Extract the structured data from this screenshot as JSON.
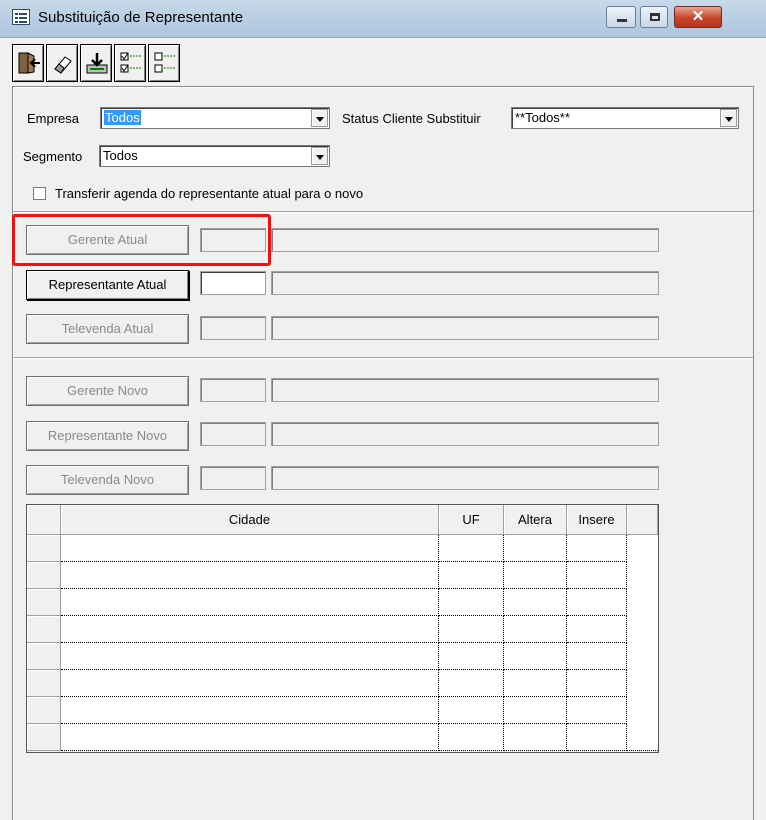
{
  "window": {
    "title": "Substituição de Representante"
  },
  "toolbar": {
    "buttons": [
      {
        "icon": "exit-door-icon"
      },
      {
        "icon": "eraser-icon"
      },
      {
        "icon": "download-tray-icon"
      },
      {
        "icon": "check-all-icon"
      },
      {
        "icon": "uncheck-all-icon"
      }
    ]
  },
  "filters": {
    "empresa_label": "Empresa",
    "empresa_value": "Todos",
    "status_label": "Status Cliente Substituir",
    "status_value": "**Todos**",
    "segmento_label": "Segmento",
    "segmento_value": "Todos",
    "transfer_label": "Transferir agenda do representante atual para o novo",
    "transfer_checked": false
  },
  "current": {
    "gerente_label": "Gerente Atual",
    "representante_label": "Representante Atual",
    "televenda_label": "Televenda Atual"
  },
  "new": {
    "gerente_label": "Gerente Novo",
    "representante_label": "Representante Novo",
    "televenda_label": "Televenda Novo"
  },
  "grid": {
    "columns": [
      "Cidade",
      "UF",
      "Altera",
      "Insere"
    ],
    "rows": 8
  },
  "colors": {
    "highlight": "#ee1111",
    "selection": "#3399ff"
  }
}
